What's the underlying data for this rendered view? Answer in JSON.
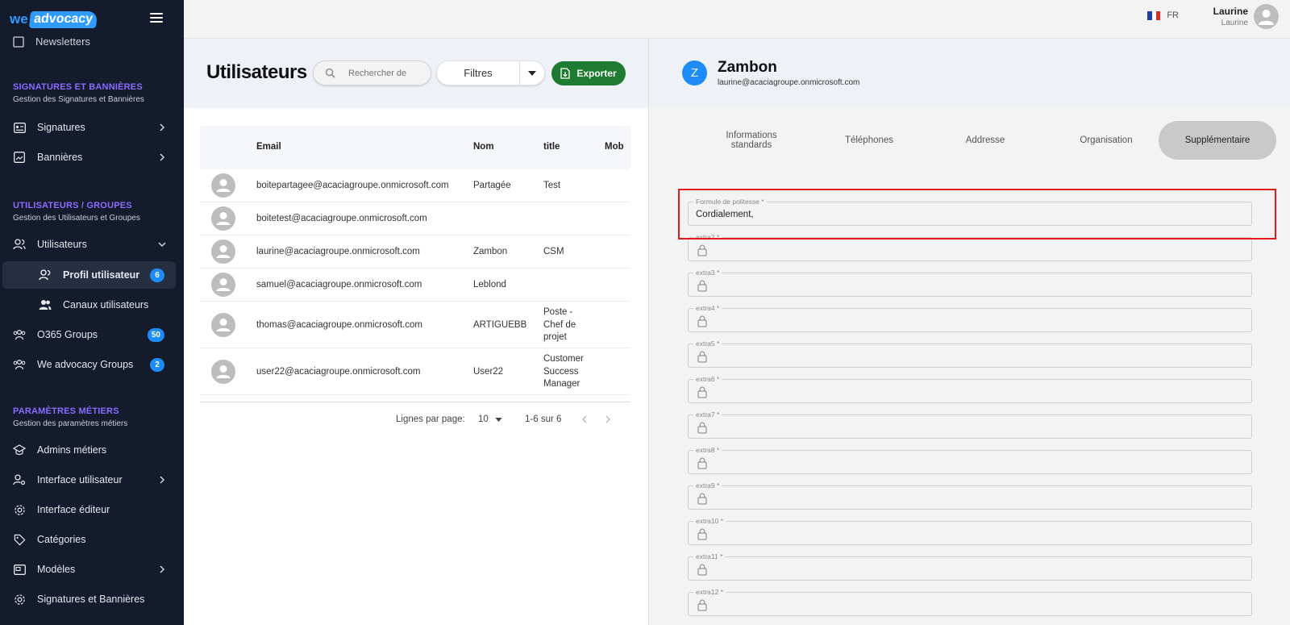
{
  "brand": {
    "we": "we",
    "advocacy": "advocacy"
  },
  "sidebar": {
    "cut_item": "Newsletters",
    "sections": [
      {
        "title": "SIGNATURES ET BANNIÈRES",
        "subtitle": "Gestion des Signatures et Bannières"
      },
      {
        "title": "UTILISATEURS / GROUPES",
        "subtitle": "Gestion des Utilisateurs et Groupes"
      },
      {
        "title": "PARAMÈTRES MÉTIERS",
        "subtitle": "Gestion des paramètres métiers"
      }
    ],
    "items": [
      {
        "label": "Signatures"
      },
      {
        "label": "Bannières"
      },
      {
        "label": "Utilisateurs"
      },
      {
        "label": "Profil utilisateur",
        "badge": "6"
      },
      {
        "label": "Canaux utilisateurs"
      },
      {
        "label": "O365 Groups",
        "badge": "50"
      },
      {
        "label": "We advocacy Groups",
        "badge": "2"
      },
      {
        "label": "Admins métiers"
      },
      {
        "label": "Interface utilisateur"
      },
      {
        "label": "Interface éditeur"
      },
      {
        "label": "Catégories"
      },
      {
        "label": "Modèles"
      },
      {
        "label": "Signatures et Bannières"
      }
    ]
  },
  "topbar": {
    "lang": "FR",
    "user_name": "Laurine",
    "user_sub": "Laurine"
  },
  "users": {
    "title": "Utilisateurs",
    "search_placeholder": "Rechercher de",
    "filters_label": "Filtres",
    "export_label": "Exporter",
    "columns": [
      "Email",
      "Nom",
      "title",
      "Mob"
    ],
    "rows": [
      {
        "email": "boitepartagee@acaciagroupe.onmicrosoft.com",
        "nom": "Partagée",
        "title": "Test"
      },
      {
        "email": "boitetest@acaciagroupe.onmicrosoft.com",
        "nom": "",
        "title": ""
      },
      {
        "email": "laurine@acaciagroupe.onmicrosoft.com",
        "nom": "Zambon",
        "title": "CSM"
      },
      {
        "email": "samuel@acaciagroupe.onmicrosoft.com",
        "nom": "Leblond",
        "title": ""
      },
      {
        "email": "thomas@acaciagroupe.onmicrosoft.com",
        "nom": "ARTIGUEBB",
        "title": "Poste - Chef de projet"
      },
      {
        "email": "user22@acaciagroupe.onmicrosoft.com",
        "nom": "User22",
        "title": "Customer Success Manager"
      }
    ],
    "pager": {
      "label": "Lignes par page:",
      "per_page": "10",
      "range": "1-6 sur 6"
    }
  },
  "detail": {
    "initial": "Z",
    "name": "Zambon",
    "email": "laurine@acaciagroupe.onmicrosoft.com",
    "tabs": [
      "Informations standards",
      "Téléphones",
      "Addresse",
      "Organisation",
      "Supplémentaire"
    ],
    "active_tab": "Supplémentaire",
    "fields": [
      {
        "label": "Formule de politesse *",
        "value": "Cordialement,"
      },
      {
        "label": "extra2 *",
        "value": ""
      },
      {
        "label": "extra3 *",
        "value": ""
      },
      {
        "label": "extra4 *",
        "value": ""
      },
      {
        "label": "extra5 *",
        "value": ""
      },
      {
        "label": "extra6 *",
        "value": ""
      },
      {
        "label": "extra7 *",
        "value": ""
      },
      {
        "label": "extra8 *",
        "value": ""
      },
      {
        "label": "extra9 *",
        "value": ""
      },
      {
        "label": "extra10 *",
        "value": ""
      },
      {
        "label": "extra11 *",
        "value": ""
      },
      {
        "label": "extra12 *",
        "value": ""
      }
    ]
  },
  "colors": {
    "sidebar_bg": "#141b2d",
    "accent": "#1d8cf8",
    "section_title": "#8c6cff",
    "export_green": "#1f7a32",
    "highlight": "#e11a1a"
  }
}
